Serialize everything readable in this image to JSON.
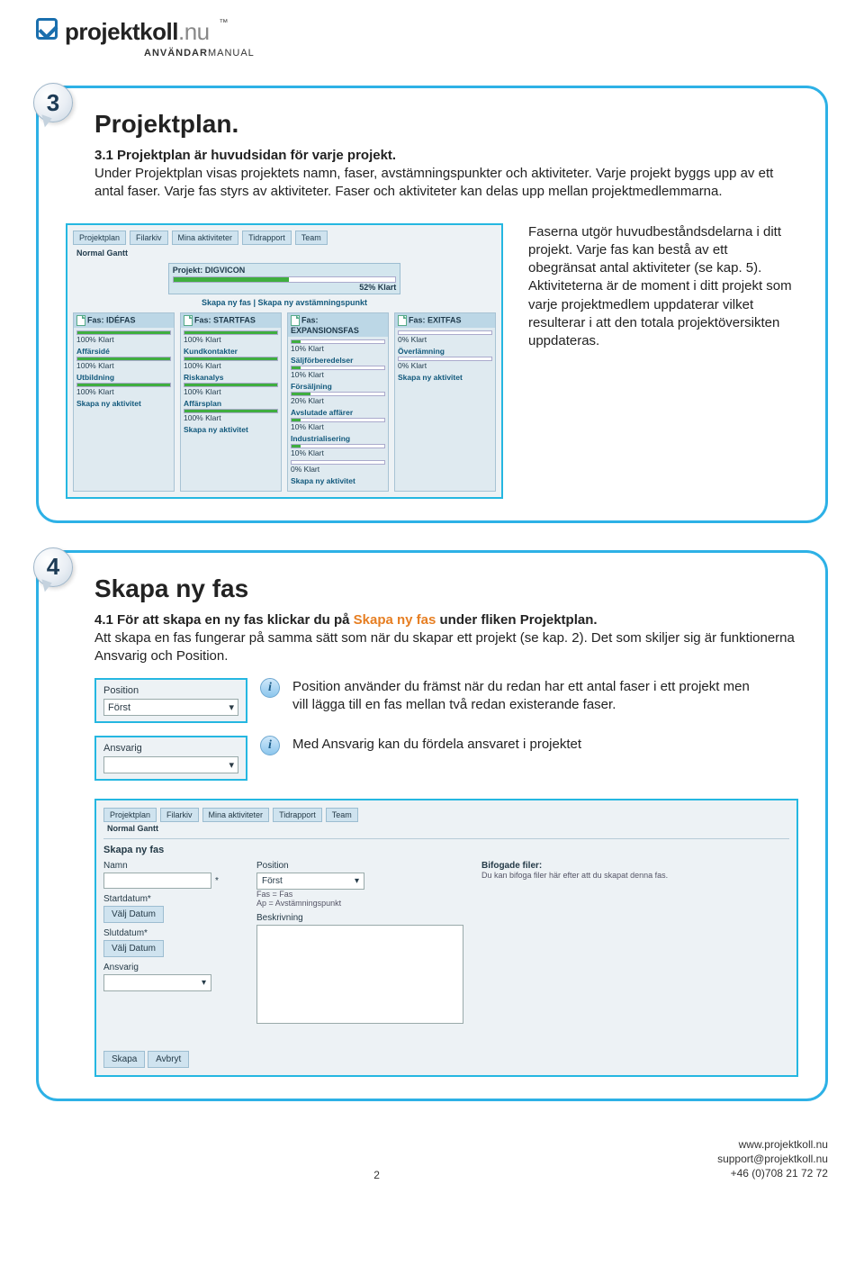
{
  "brand": {
    "name": "projektkoll",
    "tld": ".nu",
    "tm": "™",
    "subtitle_bold": "ANVÄNDAR",
    "subtitle_rest": "MANUAL"
  },
  "section3": {
    "badge": "3",
    "title": "Projektplan.",
    "sub": "3.1 Projektplan är huvudsidan för varje projekt.",
    "body": "Under Projektplan visas projektets namn, faser, avstämningspunkter och aktiviteter. Varje projekt byggs upp av ett antal faser. Varje fas styrs av aktiviteter. Faser och aktiviteter kan delas upp mellan projektmedlemmarna.",
    "aside": "Faserna utgör huvudbeståndsdelarna i ditt projekt. Varje fas kan bestå av ett obegränsat antal aktiviteter (se kap. 5). Aktiviteterna är de moment i ditt projekt som varje projektmedlem uppdaterar vilket resulterar i att den totala projektöversikten uppdateras.",
    "app": {
      "tabs": [
        "Projektplan",
        "Filarkiv",
        "Mina aktiviteter",
        "Tidrapport",
        "Team"
      ],
      "subtabs": "Normal   Gantt",
      "projectTitle": "Projekt: DIGVICON",
      "projectDone": "52% Klart",
      "projectPct": 52,
      "createLinks": "Skapa ny fas | Skapa ny avstämningspunkt",
      "phases": [
        {
          "title": "Fas: IDÉFAS",
          "items": [
            {
              "name": "Affärsidé",
              "done": "100% Klart",
              "pct": 100
            },
            {
              "name": "Utbildning",
              "done": "100% Klart",
              "pct": 100
            }
          ],
          "topPct": 100,
          "topDone": "100% Klart",
          "link": "Skapa ny aktivitet"
        },
        {
          "title": "Fas: STARTFAS",
          "items": [
            {
              "name": "Kundkontakter",
              "done": "100% Klart",
              "pct": 100
            },
            {
              "name": "Riskanalys",
              "done": "100% Klart",
              "pct": 100
            },
            {
              "name": "Affärsplan",
              "done": "100% Klart",
              "pct": 100
            }
          ],
          "topPct": 100,
          "topDone": "100% Klart",
          "link": "Skapa ny aktivitet"
        },
        {
          "title": "Fas: EXPANSIONSFAS",
          "items": [
            {
              "name": "Säljförberedelser",
              "done": "10% Klart",
              "pct": 10
            },
            {
              "name": "Försäljning",
              "done": "20% Klart",
              "pct": 20
            },
            {
              "name": "Avslutade affärer",
              "done": "10% Klart",
              "pct": 10
            },
            {
              "name": "Industrialisering",
              "done": "10% Klart",
              "pct": 10
            }
          ],
          "topPct": 10,
          "topDone": "10% Klart",
          "extraDone": "0% Klart",
          "link": "Skapa ny aktivitet"
        },
        {
          "title": "Fas: EXITFAS",
          "items": [
            {
              "name": "Överlämning",
              "done": "0% Klart",
              "pct": 0
            }
          ],
          "topPct": 0,
          "topDone": "0% Klart",
          "link": "Skapa ny aktivitet"
        }
      ]
    }
  },
  "section4": {
    "badge": "4",
    "title": "Skapa ny fas",
    "sub_pre": "4.1 För att skapa en ny fas klickar du på ",
    "sub_orange": "Skapa ny fas",
    "sub_post": " under fliken Projektplan.",
    "body": "Att skapa en fas fungerar på samma sätt som när du skapar ett projekt (se kap. 2). Det som skiljer sig är funktionerna Ansvarig och Position.",
    "posField": {
      "label": "Position",
      "value": "Först"
    },
    "ansField": {
      "label": "Ansvarig",
      "value": ""
    },
    "infoPos": "Position använder du främst när du redan har ett antal faser i ett projekt men vill lägga till en fas mellan två redan existerande faser.",
    "infoAns": "Med Ansvarig kan du fördela ansvaret i projektet",
    "app": {
      "tabs": [
        "Projektplan",
        "Filarkiv",
        "Mina aktiviteter",
        "Tidrapport",
        "Team"
      ],
      "subtabs": "Normal   Gantt",
      "heading": "Skapa ny fas",
      "labels": {
        "namn": "Namn",
        "start": "Startdatum*",
        "slut": "Slutdatum*",
        "ansvarig": "Ansvarig",
        "position": "Position",
        "posValue": "Först",
        "posHint": "Fas = Fas\nAp = Avstämningspunkt",
        "beskriv": "Beskrivning",
        "bifHead": "Bifogade filer:",
        "bifBody": "Du kan bifoga filer här efter att du skapat denna fas.",
        "pick": "Välj Datum",
        "skapa": "Skapa",
        "avbryt": "Avbryt",
        "star": "*"
      }
    }
  },
  "footer": {
    "page": "2",
    "site": "www.projektkoll.nu",
    "mail": "support@projektkoll.nu",
    "phone": "+46 (0)708 21 72 72"
  }
}
